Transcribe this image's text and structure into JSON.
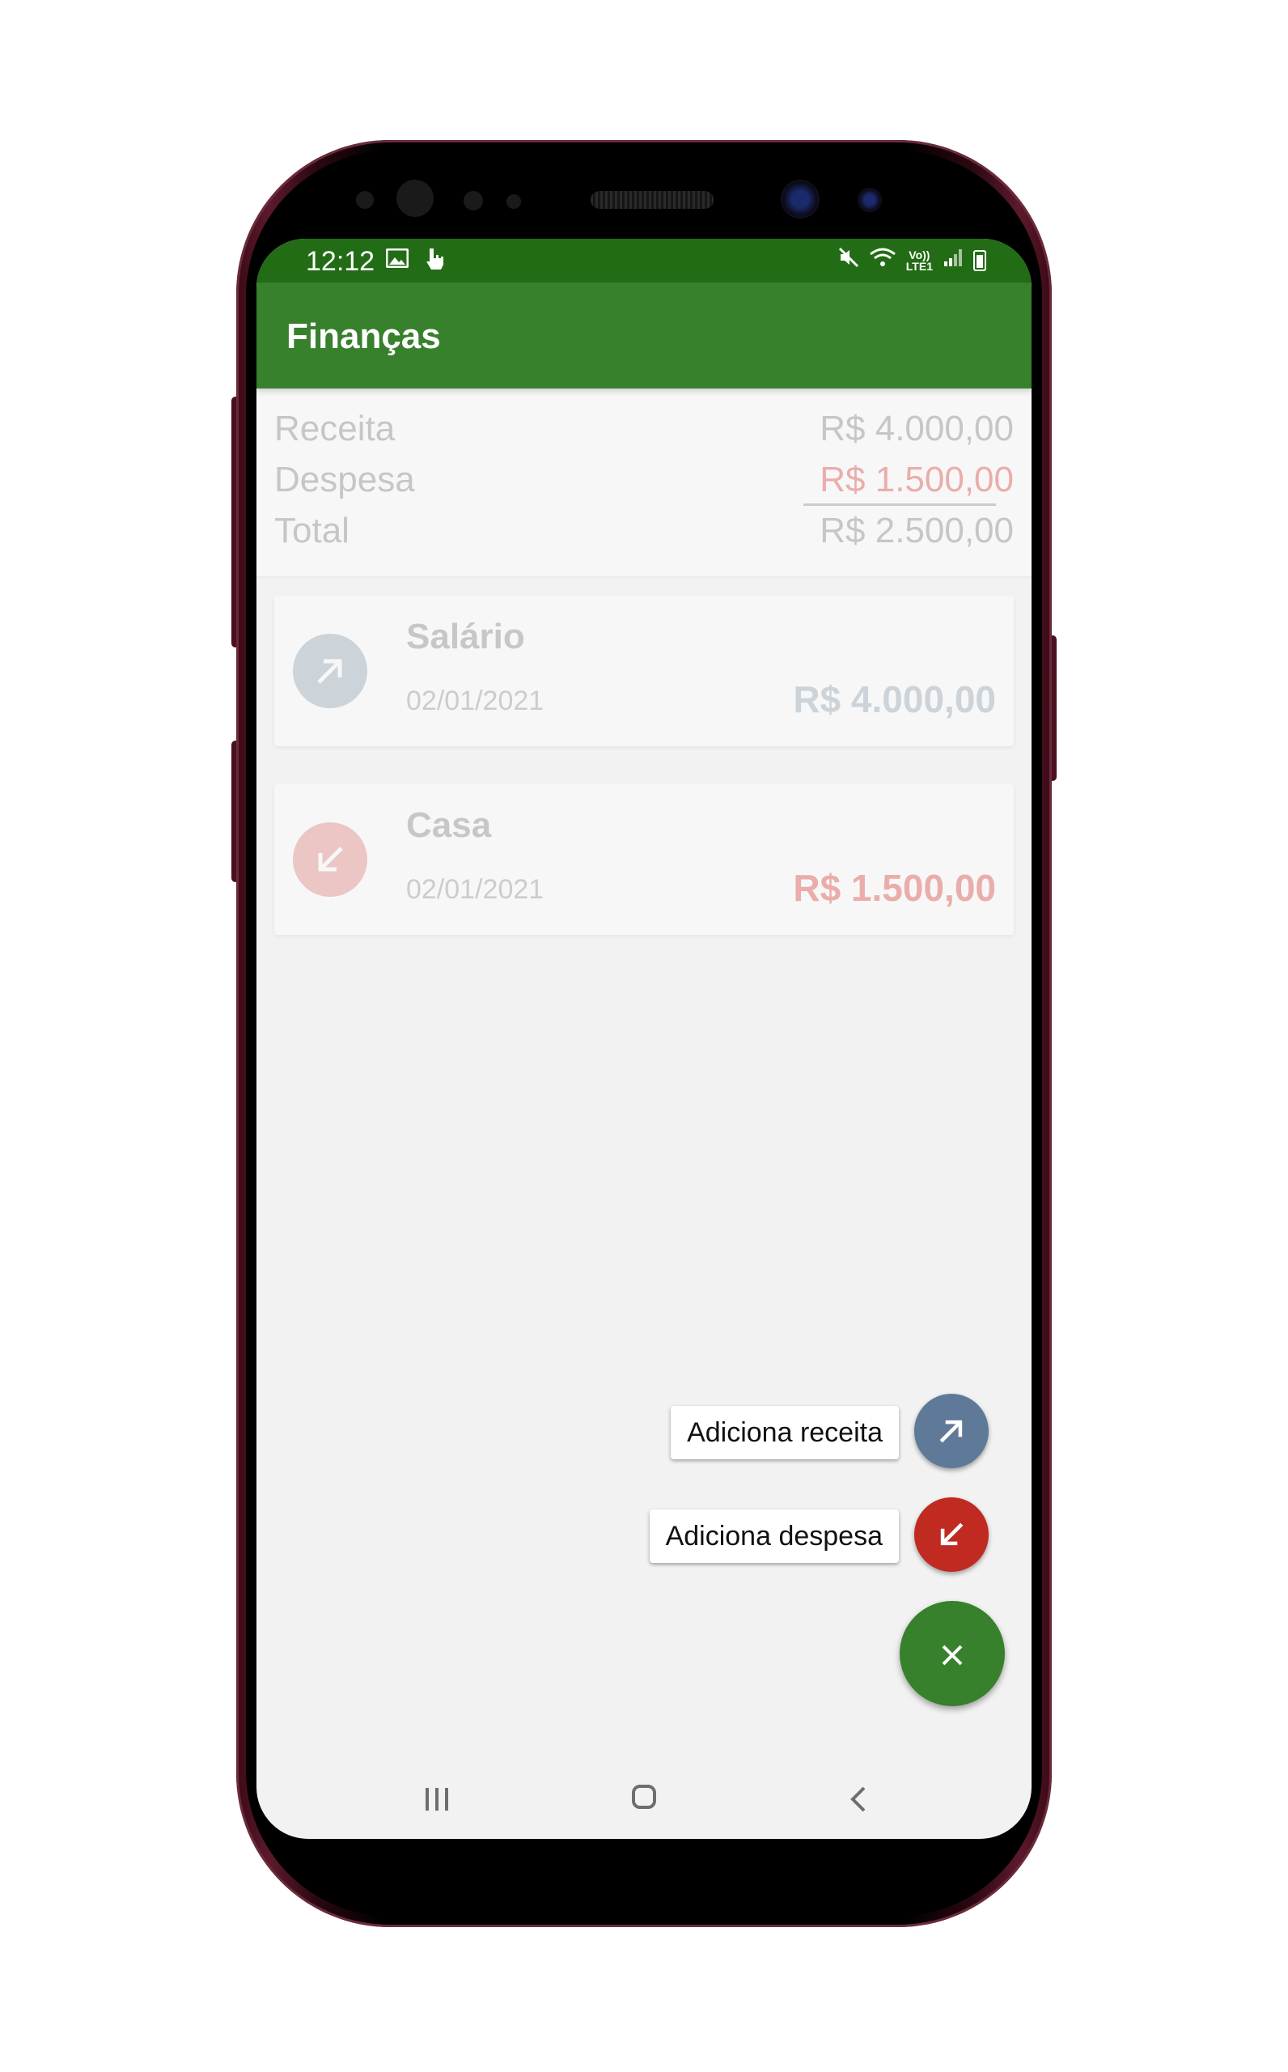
{
  "status_bar": {
    "time": "12:12",
    "left_icons": [
      "image-icon",
      "touch-icon"
    ],
    "right_icons": [
      "mute-icon",
      "wifi-icon",
      "volte-icon",
      "signal-icon",
      "battery-icon"
    ],
    "network_label_top": "Vo))",
    "network_label_bottom": "LTE1"
  },
  "app_bar": {
    "title": "Finanças",
    "color": "#37802c",
    "status_color": "#236c16"
  },
  "summary": {
    "income_label": "Receita",
    "income_value": "R$  4.000,00",
    "expense_label": "Despesa",
    "expense_value": "R$  1.500,00",
    "total_label": "Total",
    "total_value": "R$  2.500,00"
  },
  "transactions": [
    {
      "title": "Salário",
      "date": "02/01/2021",
      "amount": "R$  4.000,00",
      "type": "income",
      "icon": "arrow-up-right-icon",
      "icon_color": "#9aa9b8",
      "amount_color": "#9aa9b8"
    },
    {
      "title": "Casa",
      "date": "02/01/2021",
      "amount": "R$  1.500,00",
      "type": "expense",
      "icon": "arrow-down-left-icon",
      "icon_color": "#e38a86",
      "amount_color": "#e0504a"
    }
  ],
  "fab_menu": {
    "add_income_label": "Adiciona receita",
    "add_expense_label": "Adiciona despesa",
    "income_color": "#5f7a99",
    "expense_color": "#c12a21",
    "main_color": "#37802c",
    "main_icon": "close-icon"
  },
  "nav_bar": {
    "recents_icon": "recents-icon",
    "home_icon": "home-icon",
    "back_icon": "back-icon"
  }
}
